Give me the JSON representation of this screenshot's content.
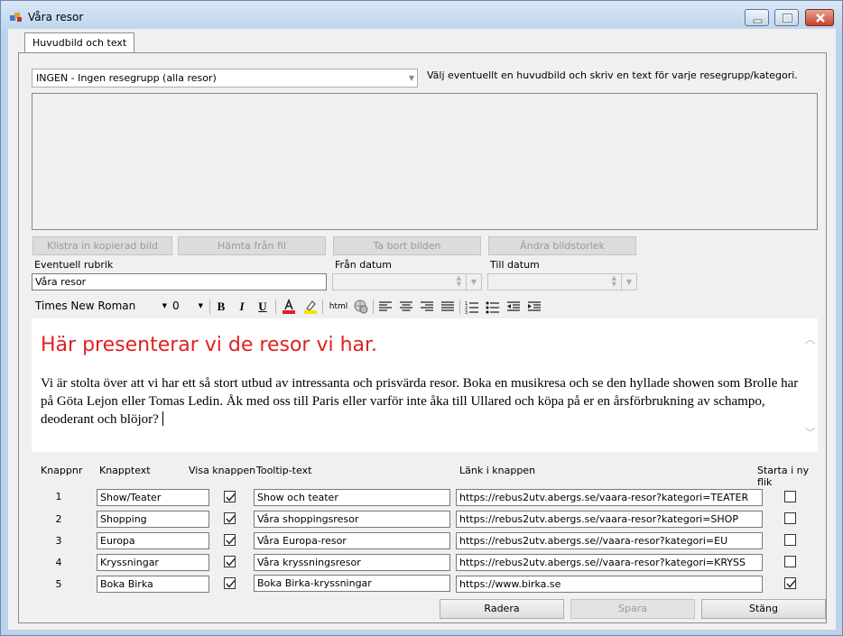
{
  "window": {
    "title": "Våra resor"
  },
  "tabs": [
    {
      "label": "Huvudbild och text"
    }
  ],
  "group": {
    "selected": "INGEN - Ingen resegrupp (alla resor)",
    "help_text": "Välj eventuellt en huvudbild och skriv en text för varje resegrupp/kategori."
  },
  "image_buttons": {
    "paste": "Klistra in kopierad bild",
    "fetch": "Hämta från fil",
    "remove": "Ta bort bilden",
    "resize": "Ändra bildstorlek"
  },
  "fields": {
    "heading_label": "Eventuell rubrik",
    "heading_value": "Våra resor",
    "from_label": "Från datum",
    "to_label": "Till datum"
  },
  "toolbar": {
    "font_name": "Times New Roman",
    "font_size": "0",
    "bold": "B",
    "italic": "I",
    "underline": "U",
    "html": "html"
  },
  "editor": {
    "heading": "Här presenterar vi de resor vi har.",
    "body": "Vi är stolta över att vi har ett så stort utbud av intressanta och prisvärda resor. Boka en musikresa och se den hyllade showen som Brolle har på Göta Lejon eller Tomas Ledin. Åk med oss till Paris eller varför inte åka till Ullared och köpa på er en årsförbrukning av schampo, deoderant och blöjor?",
    "heading_color": "#e02020"
  },
  "buttons_table": {
    "headers": {
      "nr": "Knappnr",
      "text": "Knapptext",
      "show": "Visa knappen",
      "tooltip": "Tooltip-text",
      "link": "Länk i knappen",
      "newtab": "Starta i ny flik"
    },
    "rows": [
      {
        "nr": "1",
        "text": "Show/Teater",
        "show": true,
        "tooltip": "Show och teater",
        "link": "https://rebus2utv.abergs.se/vaara-resor?kategori=TEATER",
        "newtab": false
      },
      {
        "nr": "2",
        "text": "Shopping",
        "show": true,
        "tooltip": "Våra shoppingsresor",
        "link": "https://rebus2utv.abergs.se/vaara-resor?kategori=SHOP",
        "newtab": false
      },
      {
        "nr": "3",
        "text": "Europa",
        "show": true,
        "tooltip": "Våra Europa-resor",
        "link": "https://rebus2utv.abergs.se//vaara-resor?kategori=EU",
        "newtab": false
      },
      {
        "nr": "4",
        "text": "Kryssningar",
        "show": true,
        "tooltip": "Våra kryssningsresor",
        "link": "https://rebus2utv.abergs.se//vaara-resor?kategori=KRYSS",
        "newtab": false
      },
      {
        "nr": "5",
        "text": "Boka Birka",
        "show": true,
        "tooltip": "Boka Birka-kryssningar",
        "link": "https://www.birka.se",
        "newtab": true
      }
    ]
  },
  "footer": {
    "delete": "Radera",
    "save": "Spara",
    "close": "Stäng"
  }
}
